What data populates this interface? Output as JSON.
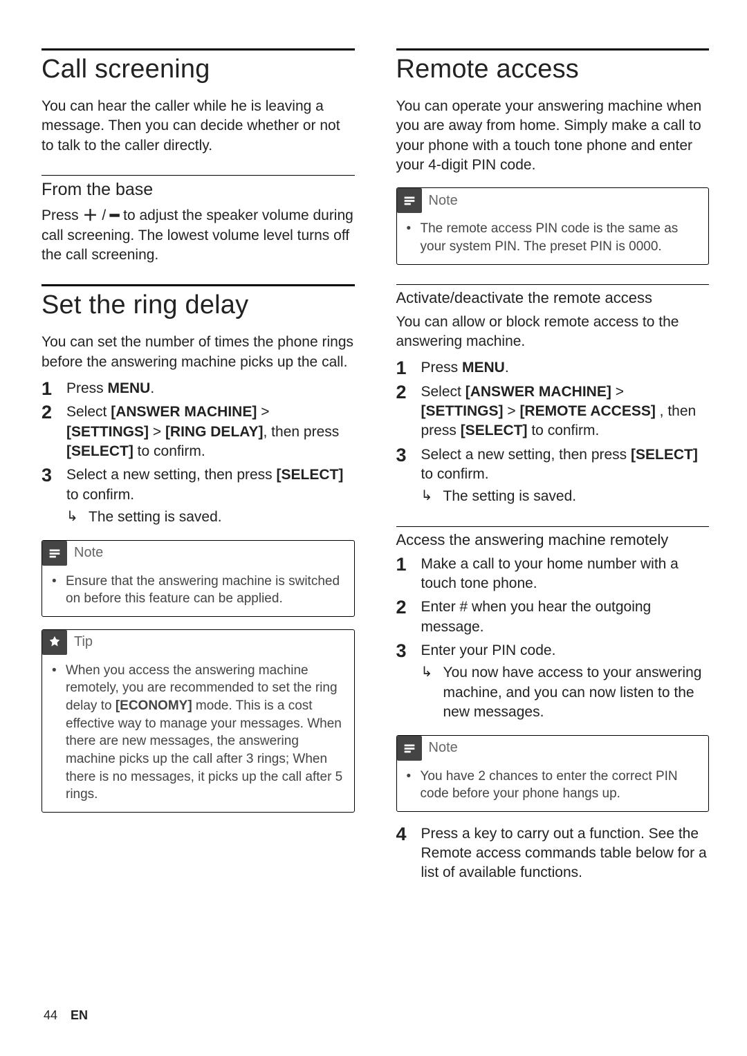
{
  "left": {
    "h1a": "Call screening",
    "p1": "You can hear the caller while he is leaving a message. Then you can decide whether or not to talk to the caller directly.",
    "h2a": "From the base",
    "p2_pre": "Press ",
    "p2_plus": "＋",
    "p2_sep": " / ",
    "p2_minus": "━",
    "p2_post": " to adjust the speaker volume during call screening. The lowest volume level turns off the call screening.",
    "h1b": "Set the ring delay",
    "p3": "You can set the number of times the phone rings before the answering machine picks up the call.",
    "steps_b": [
      {
        "pre": "Press ",
        "kw1": "MENU",
        "post": "."
      },
      {
        "pre": "Select ",
        "kw1": "[ANSWER MACHINE]",
        "mid1": " > ",
        "kw2": "[SETTINGS]",
        "mid2": " > ",
        "kw3": "[RING DELAY]",
        "post": ", then press ",
        "kw4": "[SELECT]",
        "tail": " to confirm."
      },
      {
        "pre": "Select a new setting, then press ",
        "kw1": "[SELECT]",
        "post": " to confirm.",
        "result": "The setting is saved."
      }
    ],
    "note1_title": "Note",
    "note1_items": [
      "Ensure that the answering machine is switched on before this feature can be applied."
    ],
    "tip_title": "Tip",
    "tip_pre": "When you access the answering machine remotely, you are recommended to set the ring delay to ",
    "tip_kw": "[ECONOMY]",
    "tip_post": " mode. This is a cost effective way to manage your messages. When there are new messages, the answering machine picks up the call after 3 rings; When there is no messages, it picks up the call after 5 rings."
  },
  "right": {
    "h1": "Remote access",
    "p1": "You can operate your answering machine when you are away from home. Simply make a call to your phone with a touch tone phone and enter your 4-digit PIN code.",
    "note1_title": "Note",
    "note1_items": [
      "The remote access PIN code is the same as your system PIN. The preset PIN is 0000."
    ],
    "h2a": "Activate/deactivate the remote access",
    "p2": "You can allow or block remote access to the answering machine.",
    "steps_a": [
      {
        "pre": "Press ",
        "kw1": "MENU",
        "post": "."
      },
      {
        "pre": "Select ",
        "kw1": "[ANSWER MACHINE]",
        "mid1": " > ",
        "kw2": "[SETTINGS]",
        "mid2": " > ",
        "kw3": "[REMOTE ACCESS]",
        "post": " , then press ",
        "kw4": "[SELECT]",
        "tail": " to confirm."
      },
      {
        "pre": "Select a new setting, then press ",
        "kw1": "[SELECT]",
        "post": " to confirm.",
        "result": "The setting is saved."
      }
    ],
    "h2b": "Access the answering machine remotely",
    "steps_b": [
      {
        "pre": "Make a call to your home number with a touch tone phone."
      },
      {
        "pre": "Enter # when you hear the outgoing message."
      },
      {
        "pre": "Enter your PIN code.",
        "result": "You now have access to your answering machine, and you can now listen to the new messages."
      }
    ],
    "note2_title": "Note",
    "note2_items": [
      "You have 2 chances to enter the correct PIN code before your phone hangs up."
    ],
    "steps_c": [
      {
        "num": "4",
        "pre": "Press a key to carry out a function. See the Remote access commands table below for a list of available functions."
      }
    ]
  },
  "footer": {
    "page": "44",
    "lang": "EN"
  }
}
